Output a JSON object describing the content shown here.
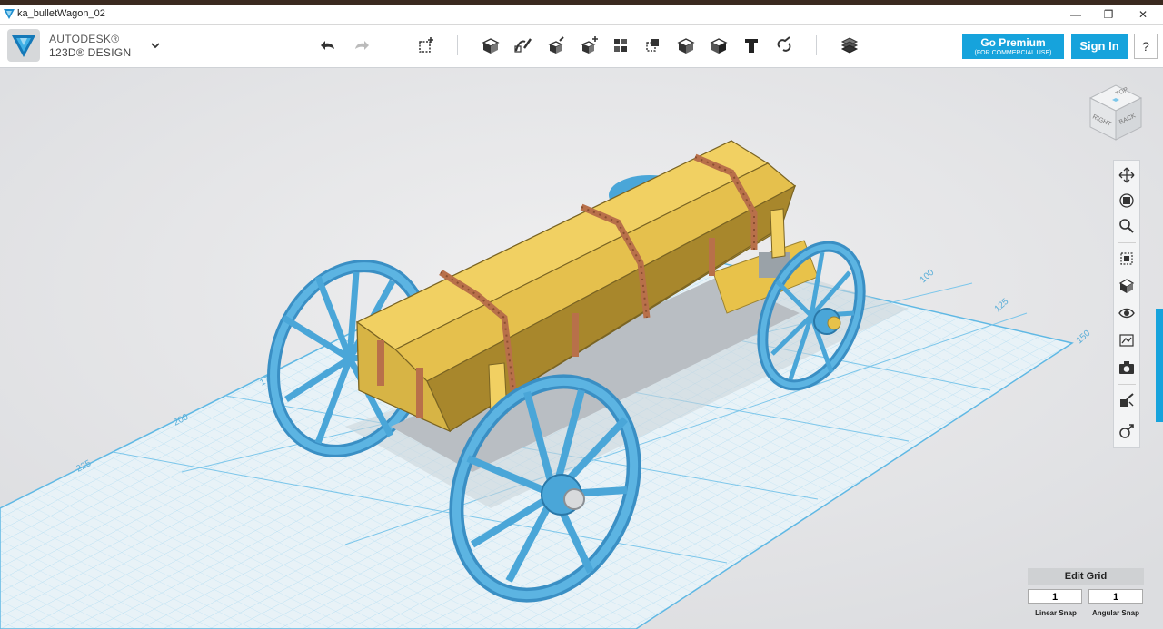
{
  "window": {
    "title": "ka_bulletWagon_02",
    "minimize": "—",
    "maximize": "❐",
    "close": "✕"
  },
  "brand": {
    "line1": "AUTODESK®",
    "line2": "123D® DESIGN"
  },
  "toolbar": {
    "premium_label": "Go Premium",
    "premium_sub": "(FOR COMMERCIAL USE)",
    "signin_label": "Sign In",
    "help_label": "?",
    "tools": [
      "undo-icon",
      "redo-icon",
      "primitives-icon",
      "sketch-icon",
      "construct-icon",
      "modify-icon",
      "pattern-icon",
      "grouping-icon",
      "combine-icon",
      "measure-icon",
      "text-icon",
      "snap-icon",
      "material-icon"
    ]
  },
  "viewcube": {
    "top": "TOP",
    "right": "RIGHT",
    "back": "BACK"
  },
  "grid_labels": [
    "100",
    "125",
    "150",
    "175",
    "200",
    "225"
  ],
  "navbar": {
    "tools": [
      "pan-icon",
      "orbit-icon",
      "zoom-icon",
      "fit-icon",
      "views-icon",
      "visibility-icon",
      "material-view-icon",
      "screenshot-icon",
      "snap-tool-icon",
      "settings-tool-icon"
    ]
  },
  "grid_panel": {
    "title": "Edit Grid",
    "linear_value": "1",
    "angular_value": "1",
    "linear_label": "Linear Snap",
    "angular_label": "Angular Snap"
  },
  "colors": {
    "accent": "#16a3dc",
    "wheel": "#4aa6d8",
    "body": "#e8c24a",
    "strap": "#b8704a",
    "grid": "#9cd4ef"
  }
}
